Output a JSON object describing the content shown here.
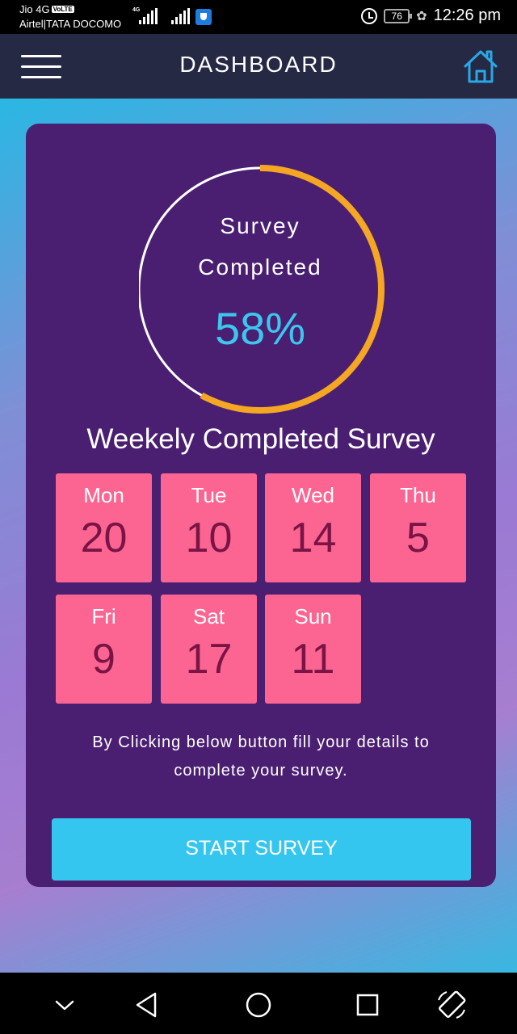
{
  "status_bar": {
    "carrier_1": "Jio 4G",
    "volte": "VoLTE",
    "carrier_2": "Airtel|TATA DOCOMO",
    "network_type": "4G",
    "battery": "76",
    "time": "12:26 pm"
  },
  "app_bar": {
    "title": "DASHBOARD"
  },
  "progress": {
    "label_line1": "Survey",
    "label_line2": "Completed",
    "percent_text": "58%",
    "percent_value": 58,
    "ring_color": "#f5a623",
    "track_color": "#ffffff",
    "percent_color": "#3dc6ee"
  },
  "weekly": {
    "title": "Weekely Completed Survey",
    "days": [
      {
        "day": "Mon",
        "count": "20"
      },
      {
        "day": "Tue",
        "count": "10"
      },
      {
        "day": "Wed",
        "count": "14"
      },
      {
        "day": "Thu",
        "count": "5"
      },
      {
        "day": "Fri",
        "count": "9"
      },
      {
        "day": "Sat",
        "count": "17"
      },
      {
        "day": "Sun",
        "count": "11"
      }
    ]
  },
  "instructions": {
    "line1": "By Clicking below button fill your details to",
    "line2": "complete your survey."
  },
  "start_button": {
    "label": "START SURVEY"
  },
  "colors": {
    "app_bar": "#252944",
    "card": "#4a1f72",
    "day_tile": "#fc6592",
    "day_count": "#7a1445",
    "button": "#35c6ef"
  },
  "nav_bar": {
    "icons": [
      "chevron-down-icon",
      "back-icon",
      "home-circle-icon",
      "recents-icon",
      "rotate-icon"
    ]
  }
}
